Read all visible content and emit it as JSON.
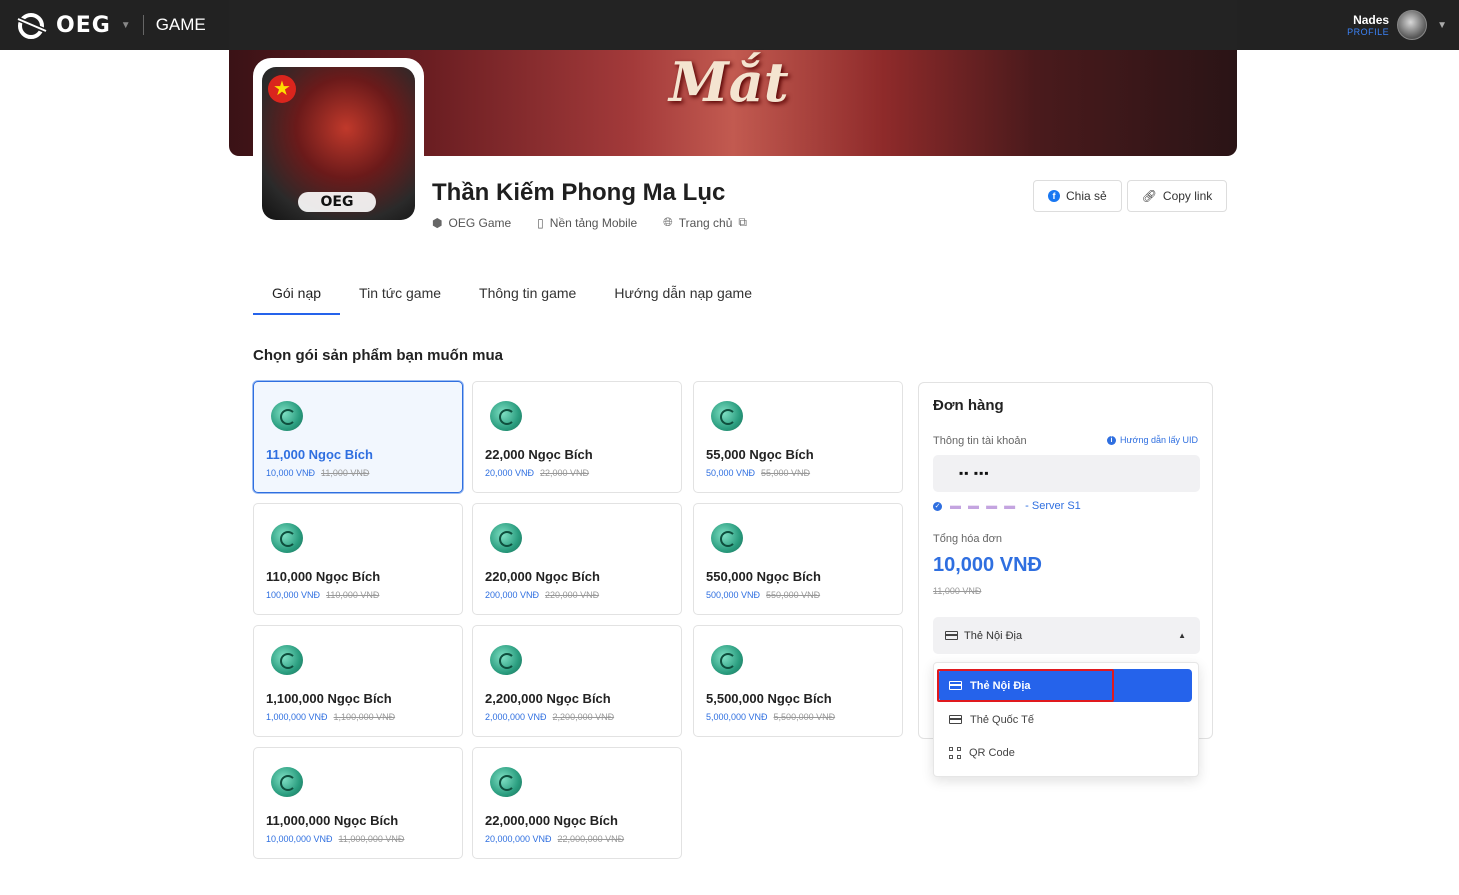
{
  "topbar": {
    "logo_text": "OEG",
    "section": "GAME",
    "user_name": "Nades",
    "user_sub": "PROFILE"
  },
  "banner": {
    "title_art": "Mắt"
  },
  "game": {
    "icon_brand": "OEG",
    "title": "Thần Kiếm Phong Ma Lục",
    "publisher": "OEG Game",
    "platform": "Nền tảng Mobile",
    "homepage": "Trang chủ",
    "share_label": "Chia sẻ",
    "copy_label": "Copy link"
  },
  "tabs": [
    {
      "label": "Gói nạp",
      "active": true
    },
    {
      "label": "Tin tức game",
      "active": false
    },
    {
      "label": "Thông tin game",
      "active": false
    },
    {
      "label": "Hướng dẫn nạp game",
      "active": false
    }
  ],
  "section_title": "Chọn gói sản phẩm bạn muốn mua",
  "products": [
    {
      "name": "11,000 Ngọc Bích",
      "price": "10,000 VNĐ",
      "old_price": "11,000 VNĐ",
      "selected": true
    },
    {
      "name": "22,000 Ngọc Bích",
      "price": "20,000 VNĐ",
      "old_price": "22,000 VNĐ"
    },
    {
      "name": "55,000 Ngọc Bích",
      "price": "50,000 VNĐ",
      "old_price": "55,000 VNĐ"
    },
    {
      "name": "110,000 Ngọc Bích",
      "price": "100,000 VNĐ",
      "old_price": "110,000 VNĐ"
    },
    {
      "name": "220,000 Ngọc Bích",
      "price": "200,000 VNĐ",
      "old_price": "220,000 VNĐ"
    },
    {
      "name": "550,000 Ngọc Bích",
      "price": "500,000 VNĐ",
      "old_price": "550,000 VNĐ"
    },
    {
      "name": "1,100,000 Ngọc Bích",
      "price": "1,000,000 VNĐ",
      "old_price": "1,100,000 VNĐ"
    },
    {
      "name": "2,200,000 Ngọc Bích",
      "price": "2,000,000 VNĐ",
      "old_price": "2,200,000 VNĐ"
    },
    {
      "name": "5,500,000 Ngọc Bích",
      "price": "5,000,000 VNĐ",
      "old_price": "5,500,000 VNĐ"
    },
    {
      "name": "11,000,000 Ngọc Bích",
      "price": "10,000,000 VNĐ",
      "old_price": "11,000,000 VNĐ"
    },
    {
      "name": "22,000,000 Ngọc Bích",
      "price": "20,000,000 VNĐ",
      "old_price": "22,000,000 VNĐ"
    }
  ],
  "order": {
    "title": "Đơn hàng",
    "account_label": "Thông tin tài khoản",
    "uid_help": "Hướng dẫn lấy UID",
    "uid_value": "▪▪ ▪▪▪",
    "server_suffix": "- Server S1",
    "total_label": "Tổng hóa đơn",
    "total_value": "10,000 VNĐ",
    "total_old": "11,000 VNĐ",
    "payment_selected": "Thẻ Nội Địa"
  },
  "payment_options": [
    {
      "label": "Thẻ Nội Địa",
      "icon": "card-icon",
      "active": true
    },
    {
      "label": "Thẻ Quốc Tế",
      "icon": "card-icon",
      "active": false
    },
    {
      "label": "QR Code",
      "icon": "qr-icon",
      "active": false
    }
  ],
  "colors": {
    "accent": "#2563eb",
    "highlight": "#e0191e",
    "topbar": "#222222"
  }
}
